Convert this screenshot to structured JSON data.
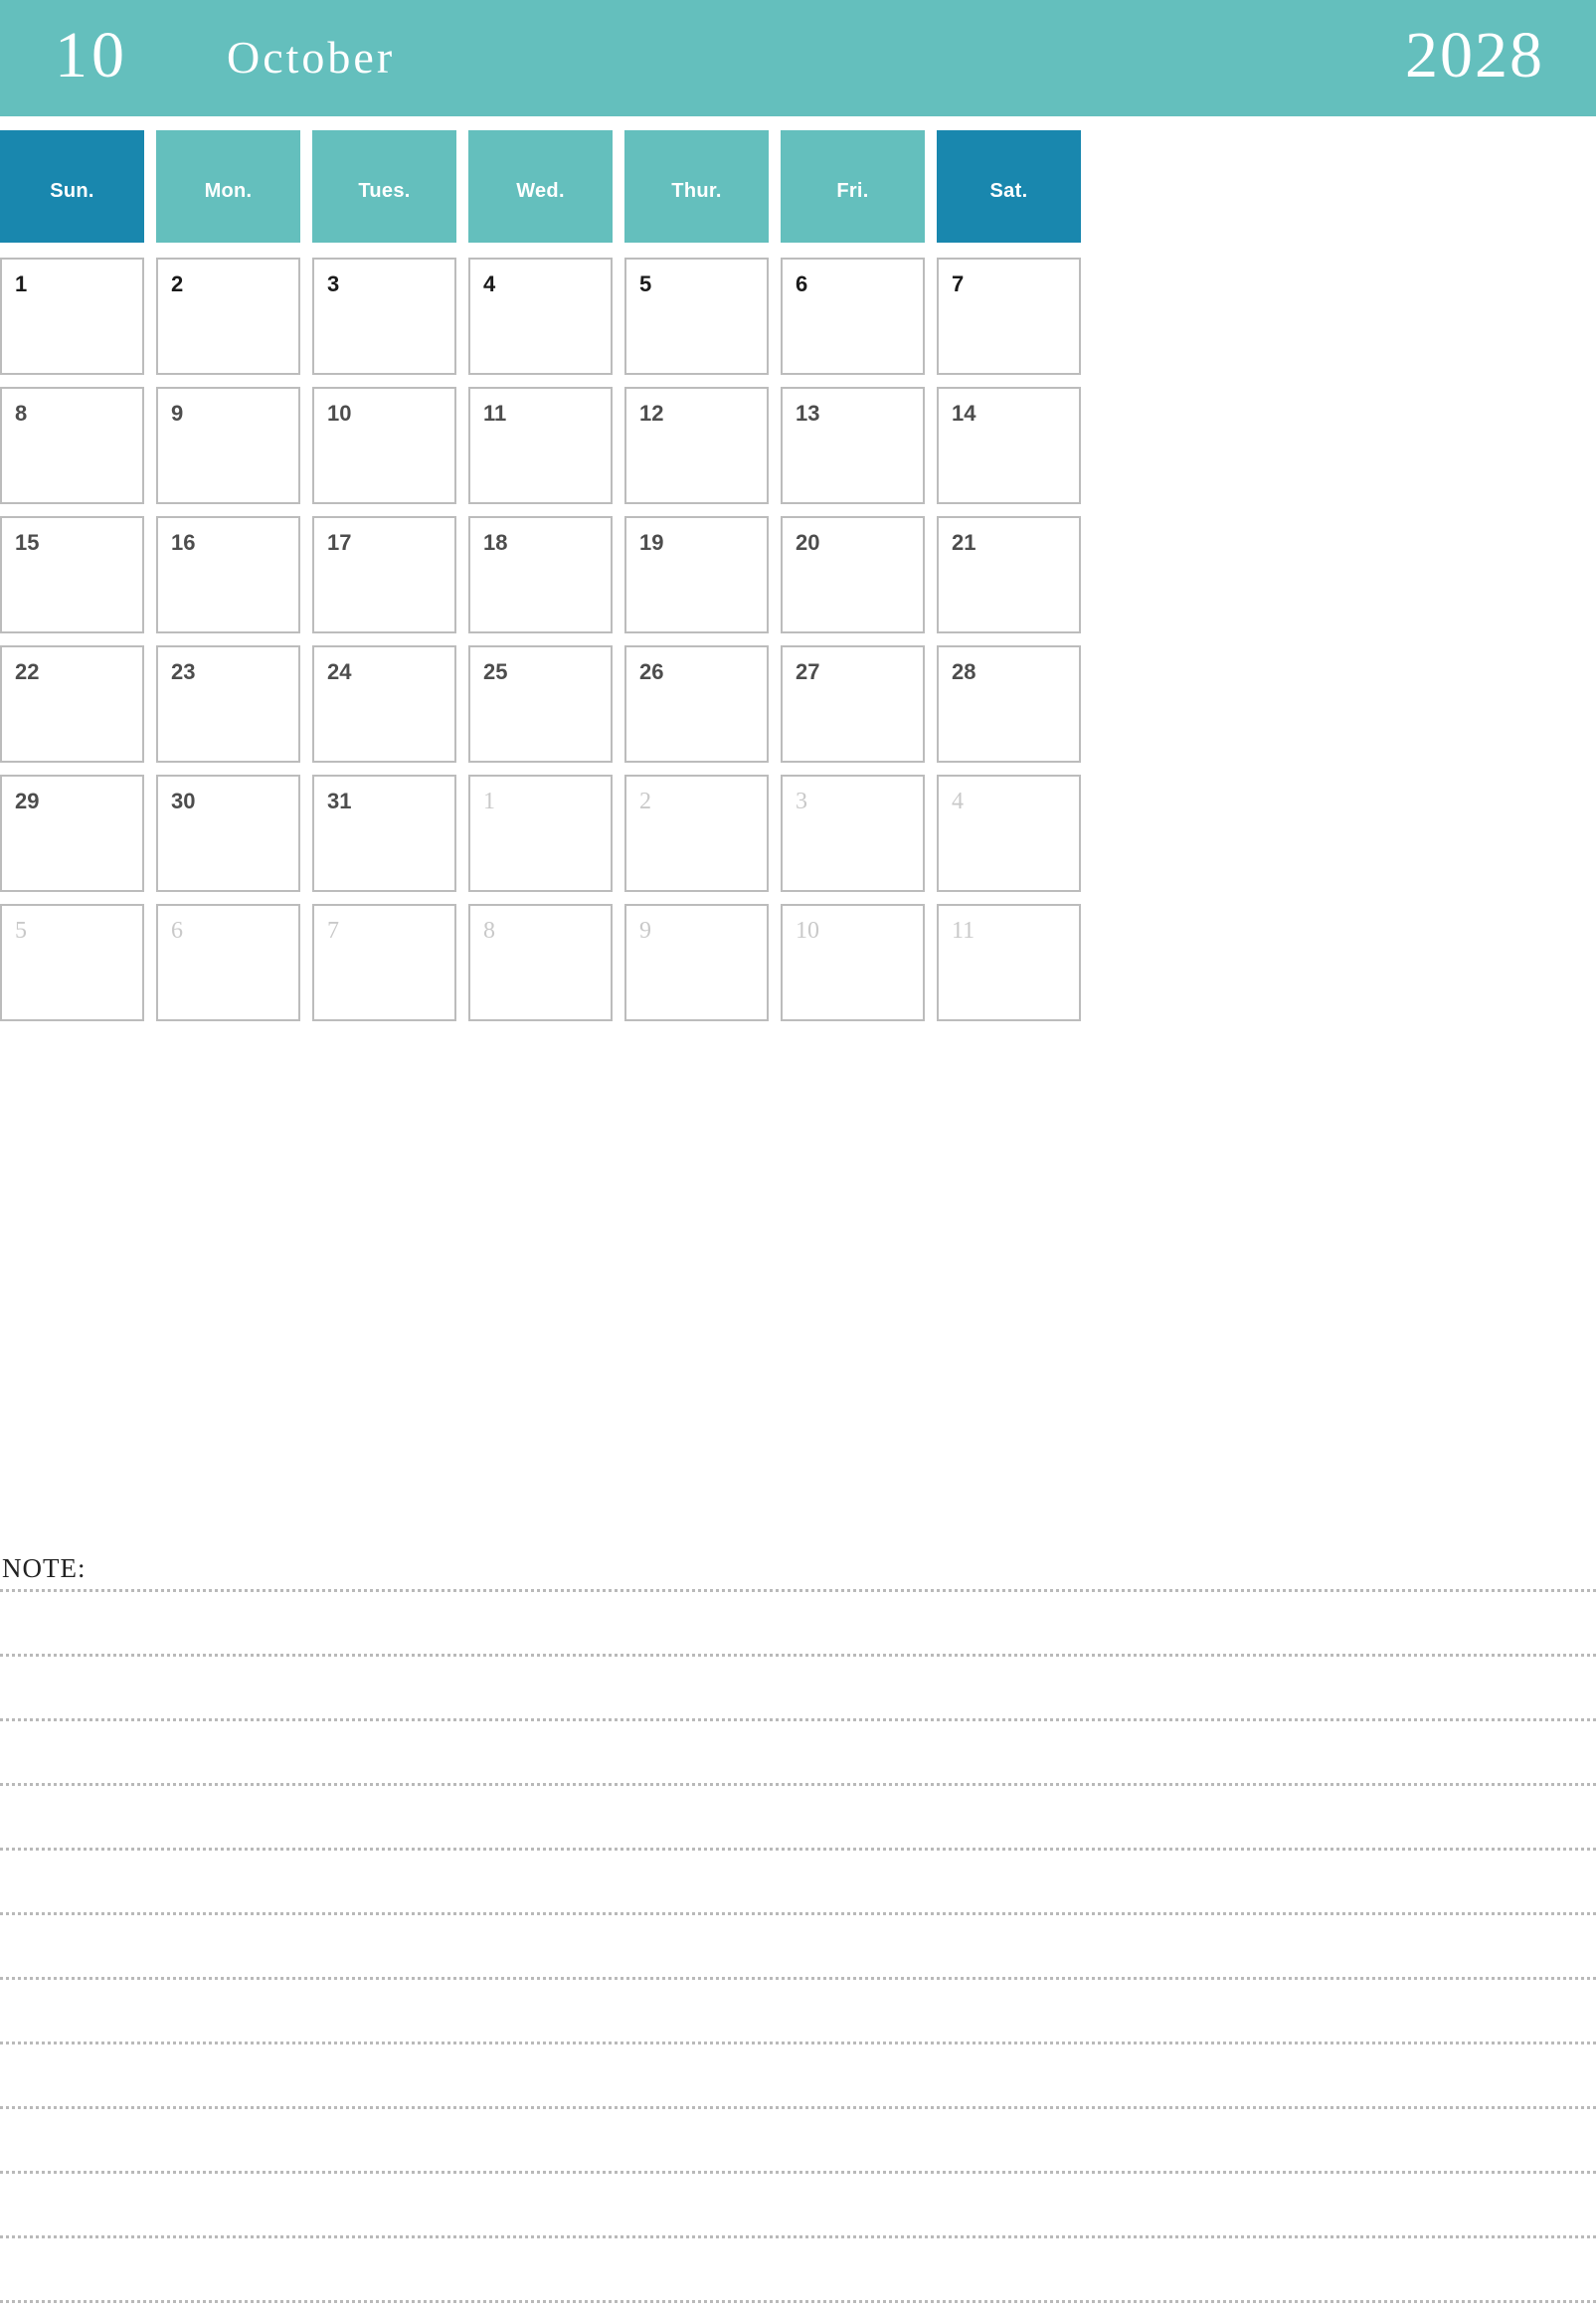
{
  "header": {
    "month_number": "10",
    "month_name": "October",
    "year": "2028",
    "background_color": "#64BFBD",
    "text_color": "#FFFFFF"
  },
  "weekdays": {
    "accent_weekend_color": "#1987AE",
    "accent_weekday_color": "#64BFBD",
    "items": [
      {
        "label": "Sun.",
        "weekend": true
      },
      {
        "label": "Mon.",
        "weekend": false
      },
      {
        "label": "Tues.",
        "weekend": false
      },
      {
        "label": "Wed.",
        "weekend": false
      },
      {
        "label": "Thur.",
        "weekend": false
      },
      {
        "label": "Fri.",
        "weekend": false
      },
      {
        "label": "Sat.",
        "weekend": true
      }
    ]
  },
  "calendar": {
    "border_color": "#BCBCBC",
    "current_month_text_color": "#4D4D4D",
    "other_month_text_color": "#C9C9C9",
    "rows": [
      [
        {
          "day": "1",
          "other": false
        },
        {
          "day": "2",
          "other": false
        },
        {
          "day": "3",
          "other": false
        },
        {
          "day": "4",
          "other": false
        },
        {
          "day": "5",
          "other": false
        },
        {
          "day": "6",
          "other": false
        },
        {
          "day": "7",
          "other": false
        }
      ],
      [
        {
          "day": "8",
          "other": false
        },
        {
          "day": "9",
          "other": false
        },
        {
          "day": "10",
          "other": false
        },
        {
          "day": "11",
          "other": false
        },
        {
          "day": "12",
          "other": false
        },
        {
          "day": "13",
          "other": false
        },
        {
          "day": "14",
          "other": false
        }
      ],
      [
        {
          "day": "15",
          "other": false
        },
        {
          "day": "16",
          "other": false
        },
        {
          "day": "17",
          "other": false
        },
        {
          "day": "18",
          "other": false
        },
        {
          "day": "19",
          "other": false
        },
        {
          "day": "20",
          "other": false
        },
        {
          "day": "21",
          "other": false
        }
      ],
      [
        {
          "day": "22",
          "other": false
        },
        {
          "day": "23",
          "other": false
        },
        {
          "day": "24",
          "other": false
        },
        {
          "day": "25",
          "other": false
        },
        {
          "day": "26",
          "other": false
        },
        {
          "day": "27",
          "other": false
        },
        {
          "day": "28",
          "other": false
        }
      ],
      [
        {
          "day": "29",
          "other": false
        },
        {
          "day": "30",
          "other": false
        },
        {
          "day": "31",
          "other": false
        },
        {
          "day": "1",
          "other": true
        },
        {
          "day": "2",
          "other": true
        },
        {
          "day": "3",
          "other": true
        },
        {
          "day": "4",
          "other": true
        }
      ],
      [
        {
          "day": "5",
          "other": true
        },
        {
          "day": "6",
          "other": true
        },
        {
          "day": "7",
          "other": true
        },
        {
          "day": "8",
          "other": true
        },
        {
          "day": "9",
          "other": true
        },
        {
          "day": "10",
          "other": true
        },
        {
          "day": "11",
          "other": true
        }
      ]
    ]
  },
  "note": {
    "label": "NOTE:",
    "line_count": 12
  }
}
